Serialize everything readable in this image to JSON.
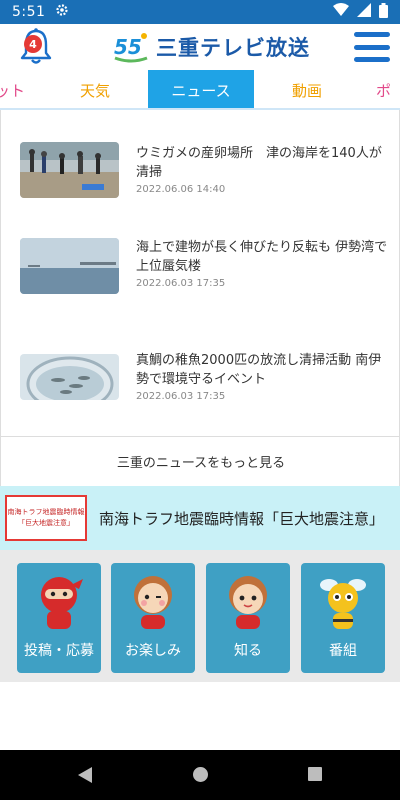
{
  "status_bar": {
    "time": "5:51"
  },
  "header": {
    "notification_count": "4",
    "logo_text": "三重テレビ放送",
    "logo_mark_text": "55"
  },
  "tabs": [
    {
      "label": "ット",
      "state": "partial"
    },
    {
      "label": "天気",
      "state": "normal"
    },
    {
      "label": "ニュース",
      "state": "active"
    },
    {
      "label": "動画",
      "state": "normal"
    },
    {
      "label": "ポ",
      "state": "partial"
    }
  ],
  "news": {
    "items": [
      {
        "title": "ウミガメの産卵場所　津の海岸を140人が清掃",
        "date": "2022.06.06 14:40",
        "thumb": "beach-cleanup"
      },
      {
        "title": "海上で建物が長く伸びたり反転も 伊勢湾で上位蜃気楼",
        "date": "2022.06.03 17:35",
        "thumb": "sea-mirage"
      },
      {
        "title": "真鯛の稚魚2000匹の放流し清掃活動 南伊勢で環境守るイベント",
        "date": "2022.06.03 17:35",
        "thumb": "fish-bucket"
      }
    ],
    "more_label": "三重のニュースをもっと見る"
  },
  "alert": {
    "thumb_line1": "南海トラフ地震臨時情報",
    "thumb_line2": "「巨大地震注意」",
    "text": "南海トラフ地震臨時情報「巨大地震注意」"
  },
  "categories": [
    {
      "label": "投稿・応募",
      "icon": "ninja-mascot-icon"
    },
    {
      "label": "お楽しみ",
      "icon": "girl-mascot-icon"
    },
    {
      "label": "知る",
      "icon": "boy-mascot-icon"
    },
    {
      "label": "番組",
      "icon": "bee-mascot-icon"
    }
  ],
  "colors": {
    "status_bar": "#1a6fb6",
    "tab_active": "#1fa3e6",
    "tab_text": "#f0a000",
    "alert_bg": "#c9f1f7",
    "category_bg": "#3fa0c4"
  }
}
